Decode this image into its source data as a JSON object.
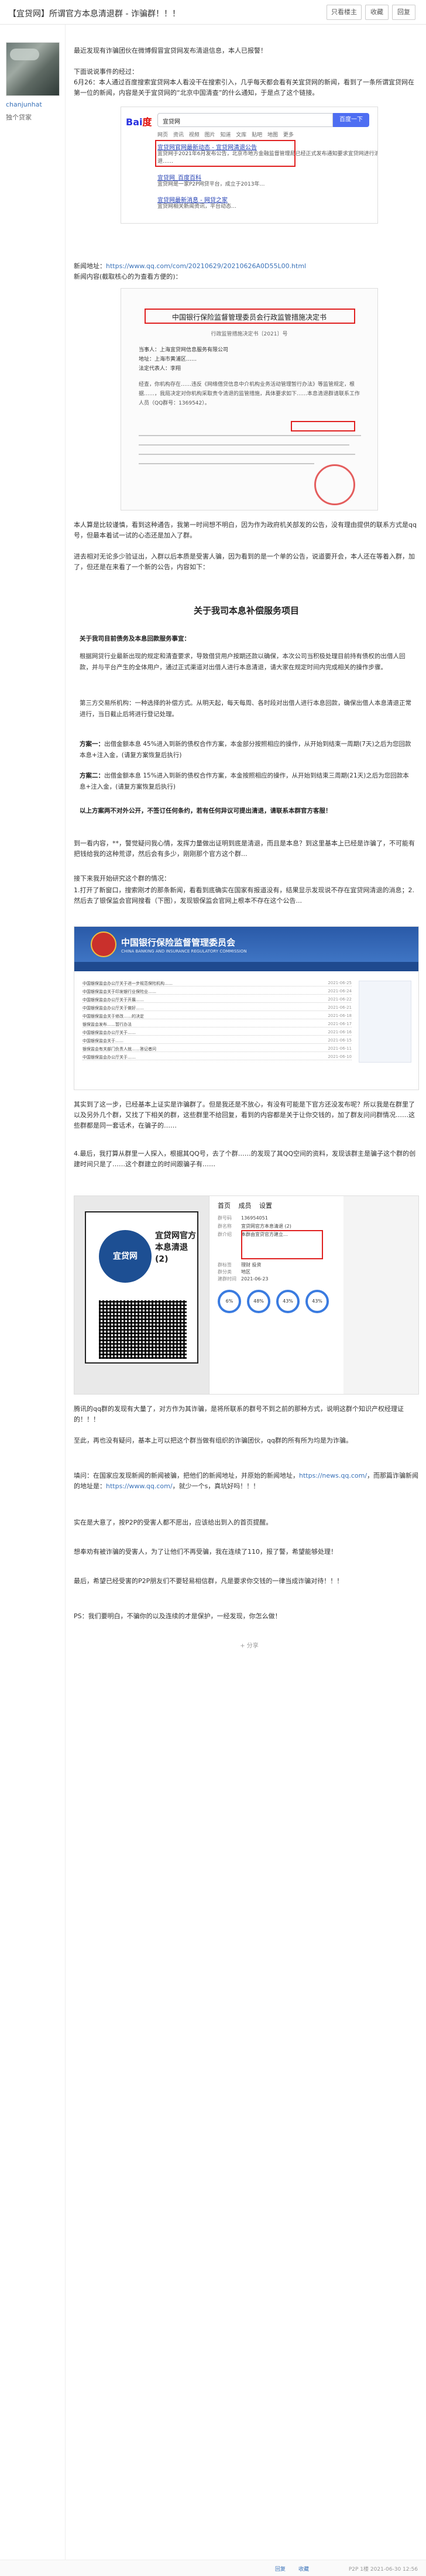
{
  "header": {
    "title": "【宜贷网】所谓官方本息清退群 - 诈骗群！！！",
    "buttons": [
      "只看楼主",
      "收藏",
      "回复"
    ]
  },
  "user": {
    "name": "chanjunhat",
    "level": "独个贷家"
  },
  "post": {
    "time": "",
    "p1": "最近发现有诈骗团伙在微博假冒宜贷网发布清退信息，本人已报警！",
    "p2a": "下面说说事件的经过：",
    "p2b": "6月26：本人通过百度搜索宜贷网本人看没干在搜索引入，几乎每天都会看有关宜贷网的新闻，看到了一条所谓宜贷网在第一位的新闻，内容是关于宜贷网的“北京中国清查”的什么通知，于是点了这个链接。",
    "baidu": {
      "logo_a": "Bai",
      "logo_b": "度",
      "query": "宜贷网",
      "button": "百度一下",
      "tabs": "网页  资讯  视频  图片  知道  文库  贴吧  地图  更多",
      "result1": "宜贷网官网最新动态 - 宜贷网清退公告",
      "result1_snip": "宜贷网于2021年6月发布公告，北京市地方金融监督管理局已经正式发布通知要求宜贷网进行清退……",
      "result2": "宜贷网_百度百科",
      "result2_snip": "宜贷网是一家P2P网贷平台，成立于2013年…",
      "result3": "宜贷网最新消息 - 网贷之家",
      "result3_snip": "宜贷网相关新闻资讯，平台动态…"
    },
    "p3a": "新闻地址：",
    "p3_link": "https://www.qq.com/com/20210629/20210626A0D55L00.html",
    "p3b": "新闻内容(截取核心的为查看方便的)：",
    "doc": {
      "title": "中国银行保险监督管理委员会行政监管措施决定书",
      "subtitle": "行政监管措施决定书〔2021〕号",
      "rows": [
        "当事人：上海宜贷网信息服务有限公司",
        "地址：上海市黄浦区……",
        "法定代表人：李翔"
      ],
      "body": "经查，你机构存在……违反《网络借贷信息中介机构业务活动管理暂行办法》等监管规定，根据……，我局决定对你机构采取责令清退的监管措施，具体要求如下……本息清退群请联系工作人员（QQ群号：1369542）。",
      "qq_group": "136954051"
    },
    "p4": "本人算是比较谨慎，看到这种通告，我第一时间想不明白，因为作为政府机关部发的公告，没有理由提供的联系方式是qq号，但最本着试一试的心态还是加入了群。",
    "p5": "进去相对无论多少验证出，入群以后本质是受害人骗，因为看到的是一个单的公告，说道要开会，本人还在等着入群，加了，但还是在来看了一个新的公告，内容如下：",
    "announcement": {
      "title": "关于我司本息补偿服务项目",
      "p1": "关于我司目前债务及本息回款服务事宜：",
      "p2": "根据网贷行业最新出现的规定和清查要求，导致借贷用户按期还款以确保，本次公司当积极处理目前持有债权的出借人回款，并与平台产生的全体用户，通过正式渠道对出借人进行本息清退，请大家在规定时间内完成相关的操作步骤。",
      "p3": "第三方交易所机构：一种选择的补偿方式。从明天起，每天每周、各时段对出借人进行本息回款，确保出借人本息清退正常进行，当日截止后将进行登记处理。",
      "p4_label": "方案一：",
      "p4": "出借金额本息 45%进入到新的债权合作方案，本金部分按照相应的操作，从开始到结束一周期(7天)之后为您回款本息+注入金，(请复方案恢复后执行)",
      "p5_label": "方案二：",
      "p5": "出借金额本息 15%进入到新的债权合作方案，本金按照相应的操作，从开始到结束三周期(21天)之后为您回款本息+注入金，(请复方案恢复后执行)",
      "p6": "以上方案两不对外公开，不签订任何条约，若有任何异议可提出清退，请联系本群官方客服！"
    },
    "p6": "到一看内容，**，警觉疑问我心情，发挥力量做出证明到底是清退，而且是本息？到这里基本上已经是诈骗了，不可能有把钱给我的这种荒谬，然后会有多少，刚刚那个官方这个群...",
    "p7": "接下来我开始研究这个群的情况：",
    "p7_list": "1.打开了新窗口，搜索刚才的那条新闻，看看到底确实在国家有报道没有，结果显示发现说不存在宜贷网清退的消息；2.然后去了银保监会官网搜看（下图），发现银保监会官网上根本不存在这个公告...",
    "cbirc": {
      "name": "中国银行保险监督管理委员会",
      "en": "CHINA BANKING AND INSURANCE REGULATORY COMMISSION",
      "rows": [
        "中国银保监会办公厅关于进一步规范保险机构……",
        "中国银保监会关于印发银行业保险业……",
        "中国银保监会办公厅关于开展……",
        "中国银保监会办公厅关于做好……",
        "中国银保监会关于修改……的决定",
        "银保监会发布……暂行办法",
        "中国银保监会办公厅关于……",
        "中国银保监会关于……",
        "银保监会有关部门负责人就……答记者问",
        "中国银保监会办公厅关于……"
      ],
      "dates": [
        "2021-06-25",
        "2021-06-24",
        "2021-06-22",
        "2021-06-21",
        "2021-06-18",
        "2021-06-17",
        "2021-06-16",
        "2021-06-15",
        "2021-06-11",
        "2021-06-10"
      ]
    },
    "p8": "其实到了这一步，已经基本上证实是诈骗群了。但是我还是不放心，有没有可能是下官方还没发布呢？所以我是在群里了以及另外几个群，又找了下相关的群，这些群里不给回复，看到的内容都是关于让你交钱的，加了群友问问群情况……这些群都是同一套话术，在骗子的……",
    "p9": "4.最后，我打算从群里一人探入，根据其QQ号，去了个群……的发现了其QQ空间的资料，发现该群主是骗子这个群的创建时间只是了……这个群建立的时间跟骗子有……",
    "wechat": {
      "logo_text": "宜贷网",
      "group_name": "宜贷网官方本息清退 (2)",
      "tabs": "首页  成员  设置",
      "rows": [
        [
          "群号码",
          "136954051"
        ],
        [
          "群名称",
          "宜贷网官方本息清退 (2)"
        ],
        [
          "群介绍",
          "本群由宜贷官方建立…"
        ],
        [
          "群标签",
          "理财 投资"
        ],
        [
          "群分类",
          "地区"
        ],
        [
          "建群时间",
          "2021-06-23"
        ]
      ],
      "stats": [
        "6%",
        "48%",
        "43%",
        "43%"
      ]
    },
    "p10": "腾讯的qq群的发现有大量了，对方作为其诈骗，是将所联系的群号不到之前的那种方式，说明这群个知识产权经理证的！！！",
    "p11": "至此，再也没有疑问，基本上可以把这个群当做有组织的诈骗团伙，qq群的所有所为均是为诈骗。",
    "p12a": "填问：在国家应发现新闻的新闻被骗，把他们的新闻地址，并原始的新闻地址，",
    "p12_link1": "https://news.qq.com/",
    "p12b": "，而那篇诈骗新闻的地址是：",
    "p12_link2": "https://www.qq.com/",
    "p12c": "，就少一个s，真坑好吗！！！",
    "p13": "实在是大意了，按P2P的受害人都不愿出，应该给出到入的首页提醒。",
    "p14": "想奉劝有被诈骗的受害人，为了让他们不再受骗，我在连续了110，报了警，希望能够处理！",
    "p15": "最后，希望已经受害的P2P朋友们不要轻易相信群，凡是要求你交钱的一律当成诈骗对待！！！",
    "p16": "PS：我们要明白，不骗你的以及连续的才是保护，一经发现，你怎么做！",
    "share": "+ 分享"
  },
  "footer": {
    "actions": [
      "回复",
      "收藏"
    ],
    "meta": "P2P 1楼 2021-06-30 12:56"
  }
}
